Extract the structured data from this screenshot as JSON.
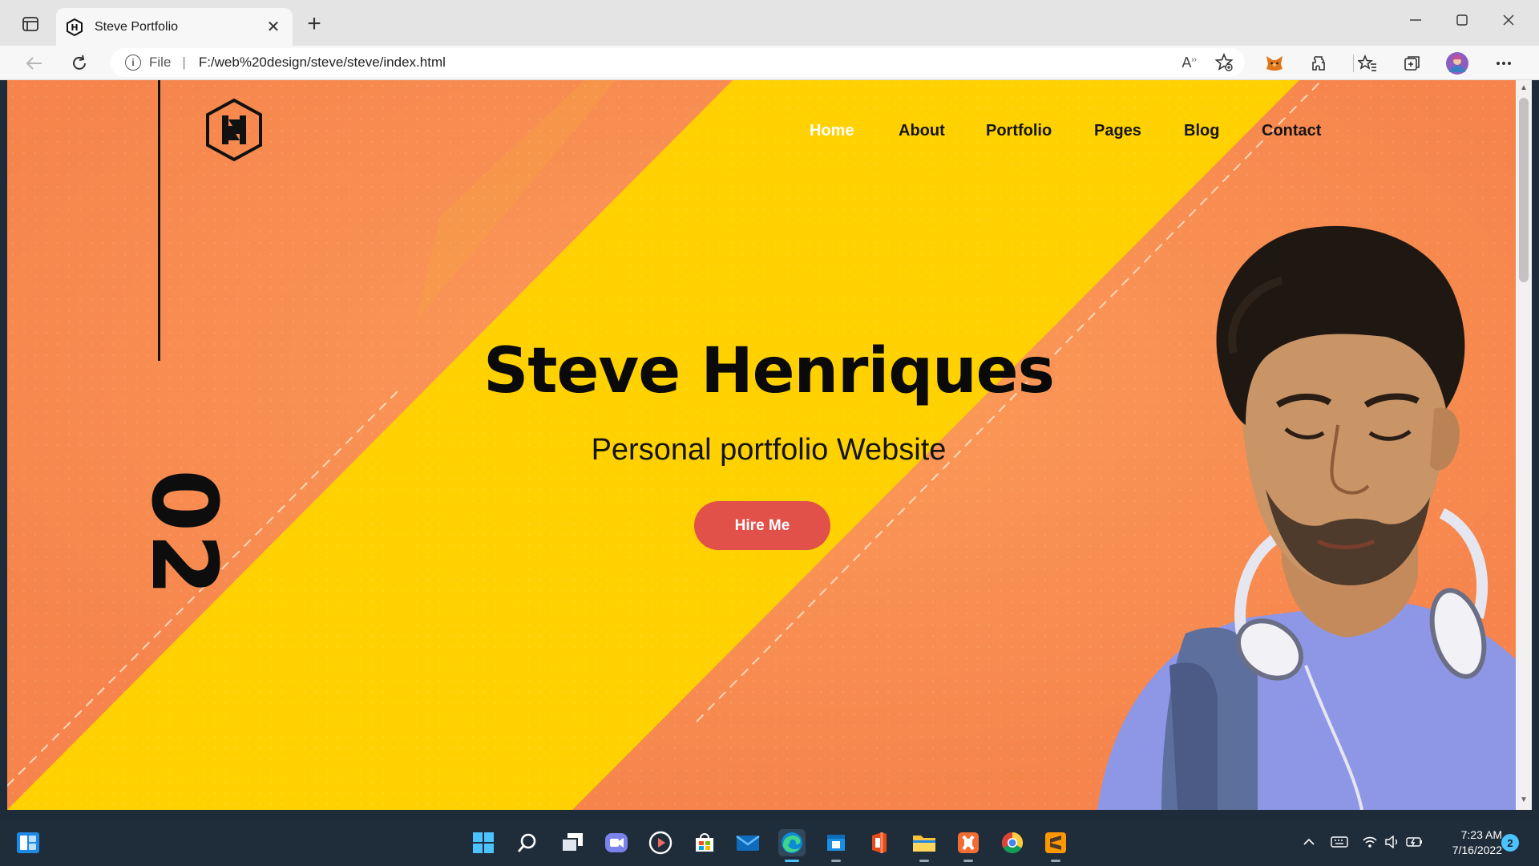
{
  "browser": {
    "tab_title": "Steve Portfolio",
    "url_scheme": "File",
    "url": "F:/web%20design/steve/steve/index.html"
  },
  "site": {
    "nav": [
      {
        "label": "Home",
        "active": true
      },
      {
        "label": "About",
        "active": false
      },
      {
        "label": "Portfolio",
        "active": false
      },
      {
        "label": "Pages",
        "active": false
      },
      {
        "label": "Blog",
        "active": false
      },
      {
        "label": "Contact",
        "active": false
      }
    ],
    "slide_number": "02",
    "hero_title": "Steve Henriques",
    "hero_subtitle": "Personal portfolio Website",
    "cta_label": "Hire Me",
    "colors": {
      "background_orange": "#f88a4a",
      "band_yellow": "#ffd100",
      "cta_red": "#e2504a",
      "nav_active": "#ffffff"
    }
  },
  "taskbar": {
    "time": "7:23 AM",
    "date": "7/16/2022",
    "notifications": "2",
    "apps": [
      "widgets-icon",
      "search-icon",
      "task-view-icon",
      "teams-chat-icon",
      "media-player-icon",
      "microsoft-store-icon",
      "mail-icon",
      "edge-icon",
      "windows-store-icon",
      "office-icon",
      "file-explorer-icon",
      "xampp-icon",
      "chrome-icon",
      "sublime-text-icon"
    ]
  }
}
